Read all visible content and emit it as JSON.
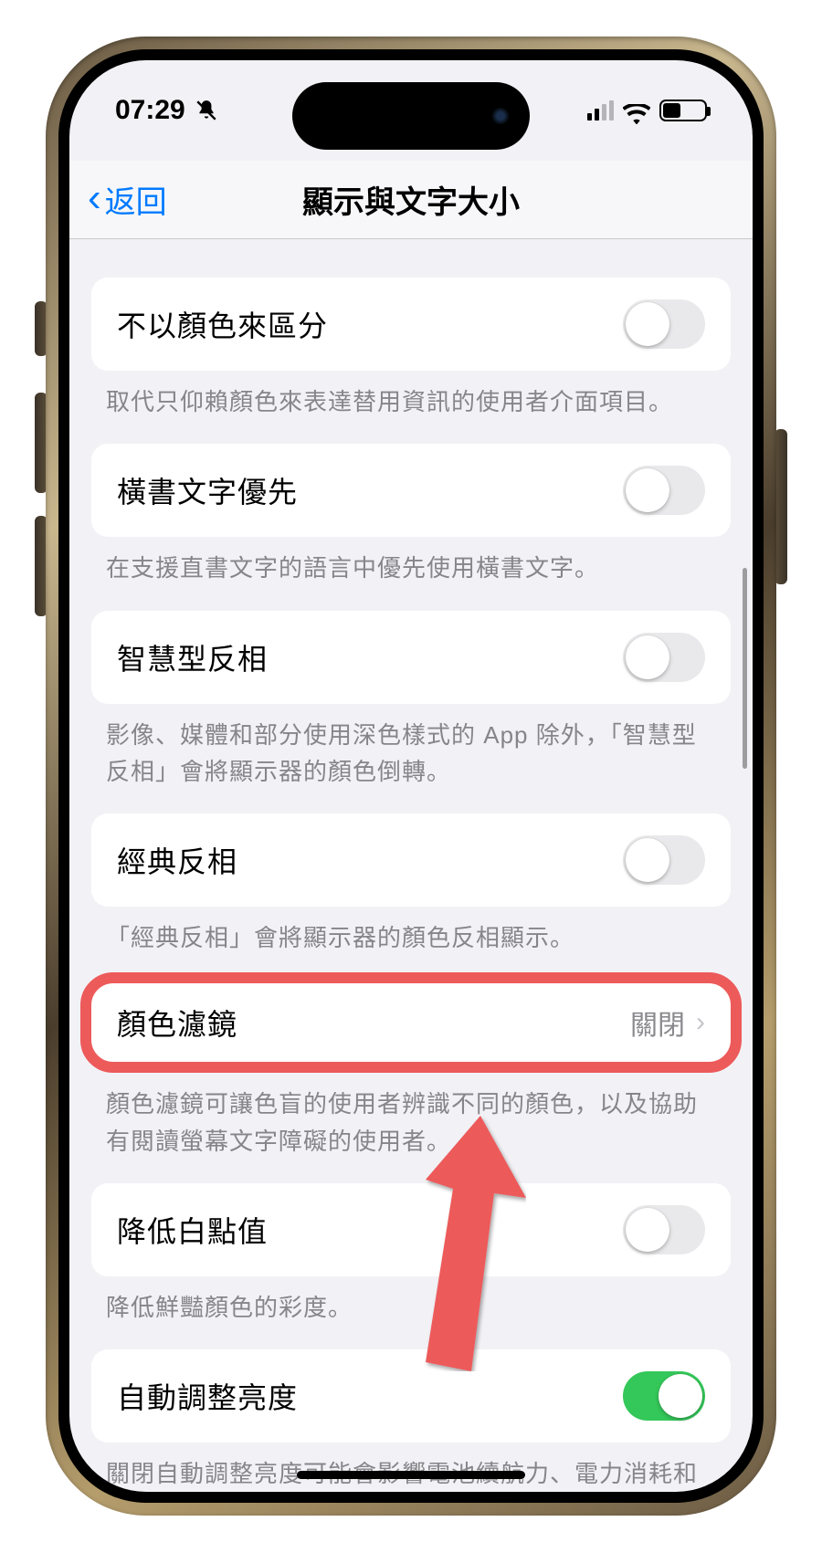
{
  "status": {
    "time": "07:29"
  },
  "nav": {
    "back": "返回",
    "title": "顯示與文字大小"
  },
  "groups": [
    {
      "label": "不以顏色來區分",
      "footer": "取代只仰賴顏色來表達替用資訊的使用者介面項目。"
    },
    {
      "label": "橫書文字優先",
      "footer": "在支援直書文字的語言中優先使用橫書文字。"
    },
    {
      "label": "智慧型反相",
      "footer": "影像、媒體和部分使用深色樣式的 App 除外，「智慧型反相」會將顯示器的顏色倒轉。"
    },
    {
      "label": "經典反相",
      "footer": "「經典反相」會將顯示器的顏色反相顯示。"
    },
    {
      "label": "顏色濾鏡",
      "value": "關閉",
      "footer": "顏色濾鏡可讓色盲的使用者辨識不同的顏色，以及協助有閱讀螢幕文字障礙的使用者。"
    },
    {
      "label": "降低白點值",
      "footer": "降低鮮豔顏色的彩度。"
    },
    {
      "label": "自動調整亮度",
      "footer": "關閉自動調整亮度可能會影響電池續航力、電力消耗和長期的螢幕效能。"
    }
  ]
}
